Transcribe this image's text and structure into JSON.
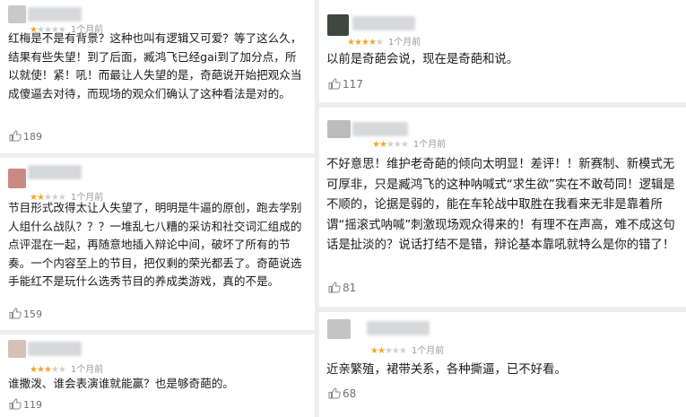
{
  "reviews_left": [
    {
      "stars": 1,
      "time": "1个月前",
      "text": "红梅是不是有背景？这种也叫有逻辑又可爱？等了这么久，结果有些失望！到了后面，臧鸿飞已经gai到了加分点，所以就使！紧！吼！而最让人失望的是，奇葩说开始把观众当成傻逼去对待，而现场的观众们确认了这种看法是对的。",
      "likes": "189",
      "avatar_color": "#c9c9c9"
    },
    {
      "stars": 2,
      "time": "1个月前",
      "text": "节目形式改得太让人失望了，明明是牛逼的原创，跑去学别人组什么战队？？？一堆乱七八糟的采访和社交词汇组成的点评混在一起，再随意地插入辩论中间，破坏了所有的节奏。一个内容至上的节目，把仅剩的荣光都丢了。奇葩说选手能红不是玩什么选秀节目的养成类游戏，真的不是。",
      "likes": "159",
      "avatar_color": "#c98a86"
    },
    {
      "stars": 3,
      "time": "1个月前",
      "text": "谁撒泼、谁会表演谁就能赢？也是够奇葩的。",
      "likes": "119",
      "avatar_color": "#d6c0b8"
    }
  ],
  "reviews_right": [
    {
      "stars": 4,
      "time": "1个月前",
      "text": "以前是奇葩会说，现在是奇葩和说。",
      "likes": "117",
      "avatar_color": "#3f4840"
    },
    {
      "stars": 2,
      "time": "1个月前",
      "text": "不好意思！维护老奇葩的倾向太明显！差评！！新赛制、新模式无可厚非，只是臧鸿飞的这种呐喊式“求生欲”实在不敢苟同！逻辑是不顺的，论据是弱的，能在车轮战中取胜在我看来无非是靠着所谓“摇滚式呐喊”刺激现场观众得来的！有理不在声高，难不成这句话是扯淡的？说话打结不是错，辩论基本靠吼就特么是你的错了！",
      "likes": "81",
      "avatar_color": "#bcbcbc"
    },
    {
      "stars": 2,
      "time": "1个月前",
      "text": "近亲繁殖，裙带关系，各种撕逼，已不好看。",
      "likes": "68",
      "avatar_color": "#c4c4c4"
    }
  ]
}
